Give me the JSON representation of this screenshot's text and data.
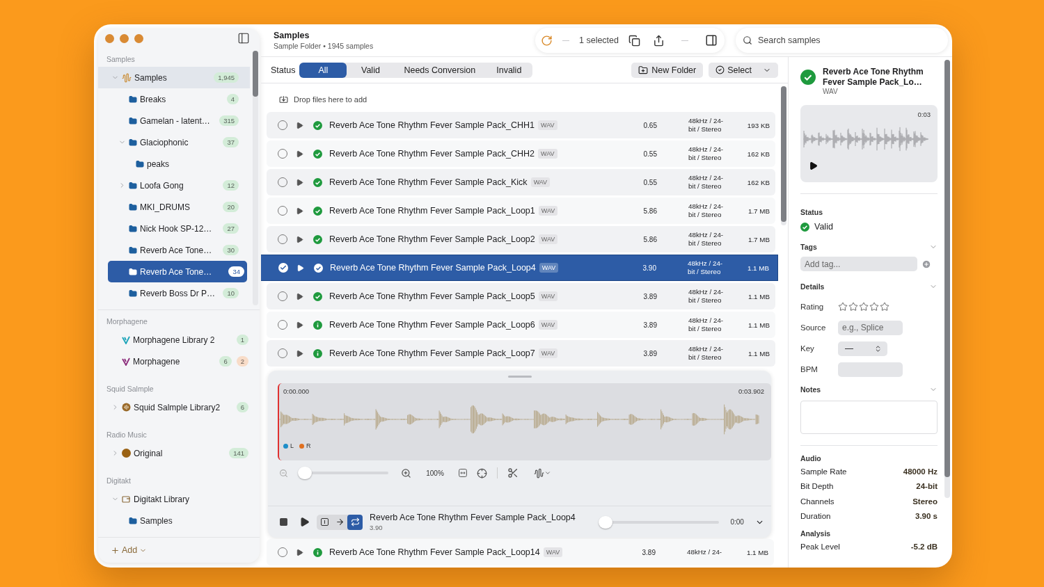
{
  "sidebar": {
    "sections": [
      {
        "title": "Samples",
        "items": [
          {
            "label": "Samples",
            "kind": "waveform",
            "badges": [
              {
                "text": "1,945",
                "color": "#d3ecd8"
              }
            ],
            "expanded": true,
            "selected": false,
            "highlighted": true,
            "children": [
              {
                "label": "Breaks",
                "kind": "folder",
                "badges": [
                  {
                    "text": "4",
                    "color": "#d3ecd8"
                  }
                ],
                "selected": false,
                "highlighted": false
              },
              {
                "label": "Gamelan - latent…",
                "kind": "folder",
                "badges": [
                  {
                    "text": "315",
                    "color": "#d3ecd8"
                  }
                ],
                "selected": false,
                "highlighted": false
              },
              {
                "label": "Glaciophonic",
                "kind": "folder",
                "badges": [
                  {
                    "text": "37",
                    "color": "#d3ecd8"
                  }
                ],
                "expanded": true,
                "selected": false,
                "highlighted": false,
                "children": [
                  {
                    "label": "peaks",
                    "kind": "folder",
                    "selected": false,
                    "highlighted": false
                  }
                ]
              },
              {
                "label": "Loofa Gong",
                "kind": "folder",
                "badges": [
                  {
                    "text": "12",
                    "color": "#d3ecd8"
                  }
                ],
                "expanded": false,
                "selected": false,
                "highlighted": false
              },
              {
                "label": "MKI_DRUMS",
                "kind": "folder",
                "badges": [
                  {
                    "text": "20",
                    "color": "#d3ecd8"
                  }
                ],
                "selected": false,
                "highlighted": false
              },
              {
                "label": "Nick Hook SP-12…",
                "kind": "folder",
                "badges": [
                  {
                    "text": "27",
                    "color": "#d3ecd8"
                  }
                ],
                "selected": false,
                "highlighted": false
              },
              {
                "label": "Reverb Ace Tone…",
                "kind": "folder",
                "badges": [
                  {
                    "text": "30",
                    "color": "#d3ecd8"
                  }
                ],
                "selected": false,
                "highlighted": false
              },
              {
                "label": "Reverb Ace Tone…",
                "kind": "folder",
                "badges": [
                  {
                    "text": "34",
                    "color": "#ffffff"
                  }
                ],
                "selected": true,
                "highlighted": false
              },
              {
                "label": "Reverb Boss Dr P…",
                "kind": "folder",
                "badges": [
                  {
                    "text": "10",
                    "color": "#d3ecd8"
                  }
                ],
                "selected": false,
                "highlighted": false
              }
            ]
          }
        ]
      },
      {
        "title": "Morphagene",
        "items": [
          {
            "label": "Morphagene Library 2",
            "kind": "morph",
            "color": "#1aa3b8",
            "badges": [
              {
                "text": "1",
                "color": "#d3ecd8"
              }
            ],
            "selected": false,
            "highlighted": false
          },
          {
            "label": "Morphagene",
            "kind": "morph",
            "color": "#8a2a7a",
            "badges": [
              {
                "text": "6",
                "color": "#d3ecd8"
              },
              {
                "text": "2",
                "color": "#f8dcc8"
              }
            ],
            "selected": false,
            "highlighted": false
          }
        ]
      },
      {
        "title": "Squid Salmple",
        "items": [
          {
            "label": "Squid Salmple Library2",
            "kind": "disc",
            "badges": [
              {
                "text": "6",
                "color": "#d3ecd8"
              }
            ],
            "expanded": false,
            "selected": false,
            "highlighted": false
          }
        ]
      },
      {
        "title": "Radio Music",
        "items": [
          {
            "label": "Original",
            "kind": "dot",
            "badges": [
              {
                "text": "141",
                "color": "#d3ecd8"
              }
            ],
            "expanded": false,
            "selected": false,
            "highlighted": false
          }
        ]
      },
      {
        "title": "Digitakt",
        "items": [
          {
            "label": "Digitakt Library",
            "kind": "card",
            "expanded": true,
            "selected": false,
            "highlighted": false,
            "children": [
              {
                "label": "Samples",
                "kind": "folder",
                "selected": false,
                "highlighted": false
              }
            ]
          }
        ]
      }
    ],
    "add_label": "Add"
  },
  "header": {
    "title": "Samples",
    "subtitle": "Sample Folder • 1945 samples",
    "selection": "1 selected",
    "search": {
      "placeholder": "Search samples"
    }
  },
  "filter": {
    "label": "Status",
    "segments": [
      {
        "label": "All",
        "selected": true
      },
      {
        "label": "Valid",
        "selected": false
      },
      {
        "label": "Needs Conversion",
        "selected": false
      },
      {
        "label": "Invalid",
        "selected": false
      }
    ],
    "new_folder": "New Folder",
    "select": "Select"
  },
  "drop_hint": "Drop files here to add",
  "rows": [
    {
      "name": "Reverb Ace Tone Rhythm Fever Sample Pack_CHH1",
      "format": "WAV",
      "kind": "valid",
      "duration": "0.65",
      "audio": "48kHz / 24-bit / Stereo",
      "size": "193 KB",
      "selected": false
    },
    {
      "name": "Reverb Ace Tone Rhythm Fever Sample Pack_CHH2",
      "format": "WAV",
      "kind": "valid",
      "duration": "0.55",
      "audio": "48kHz / 24-bit / Stereo",
      "size": "162 KB",
      "selected": false
    },
    {
      "name": "Reverb Ace Tone Rhythm Fever Sample Pack_Kick",
      "format": "WAV",
      "kind": "valid",
      "duration": "0.55",
      "audio": "48kHz / 24-bit / Stereo",
      "size": "162 KB",
      "selected": false
    },
    {
      "name": "Reverb Ace Tone Rhythm Fever Sample Pack_Loop1",
      "format": "WAV",
      "kind": "valid",
      "duration": "5.86",
      "audio": "48kHz / 24-bit / Stereo",
      "size": "1.7 MB",
      "selected": false
    },
    {
      "name": "Reverb Ace Tone Rhythm Fever Sample Pack_Loop2",
      "format": "WAV",
      "kind": "valid",
      "duration": "5.86",
      "audio": "48kHz / 24-bit / Stereo",
      "size": "1.7 MB",
      "selected": false
    },
    {
      "name": "Reverb Ace Tone Rhythm Fever Sample Pack_Loop4",
      "format": "WAV",
      "kind": "valid",
      "duration": "3.90",
      "audio": "48kHz / 24-bit / Stereo",
      "size": "1.1 MB",
      "selected": true
    },
    {
      "name": "Reverb Ace Tone Rhythm Fever Sample Pack_Loop5",
      "format": "WAV",
      "kind": "valid",
      "duration": "3.89",
      "audio": "48kHz / 24-bit / Stereo",
      "size": "1.1 MB",
      "selected": false
    },
    {
      "name": "Reverb Ace Tone Rhythm Fever Sample Pack_Loop6",
      "format": "WAV",
      "kind": "info",
      "duration": "3.89",
      "audio": "48kHz / 24-bit / Stereo",
      "size": "1.1 MB",
      "selected": false
    },
    {
      "name": "Reverb Ace Tone Rhythm Fever Sample Pack_Loop7",
      "format": "WAV",
      "kind": "info",
      "duration": "3.89",
      "audio": "48kHz / 24-bit / Stereo",
      "size": "1.1 MB",
      "selected": false
    }
  ],
  "last_row": {
    "name": "Reverb Ace Tone Rhythm Fever Sample Pack_Loop14",
    "format": "WAV",
    "kind": "info",
    "duration": "3.89",
    "audio": "48kHz / 24-",
    "size": "1.1 MB",
    "selected": false
  },
  "player": {
    "start": "0:00.000",
    "end": "0:03.902",
    "channels": [
      {
        "label": "L",
        "color": "#1e8ec8"
      },
      {
        "label": "R",
        "color": "#e07020"
      }
    ],
    "zoom": {
      "level": 0,
      "reading": "100%"
    },
    "modes": [
      {
        "kind": "once",
        "selected": false
      },
      {
        "kind": "next",
        "selected": false
      },
      {
        "kind": "loop",
        "selected": true
      }
    ],
    "title": "Reverb Ace Tone Rhythm Fever Sample Pack_Loop4",
    "duration": "3.90",
    "progress": {
      "level": 0,
      "reading": "0:00"
    }
  },
  "inspector": {
    "title": "Reverb Ace Tone Rhythm Fever Sample Pack_Lo…",
    "format": "WAV",
    "preview_time": "0:03",
    "status": {
      "heading": "Status",
      "value": "Valid"
    },
    "tags": {
      "heading": "Tags",
      "expanded": true,
      "placeholder": "Add tag..."
    },
    "details": {
      "heading": "Details",
      "expanded": true,
      "fields": [
        {
          "kind": "rating",
          "label": "Rating",
          "stars": 0
        },
        {
          "kind": "text",
          "label": "Source",
          "placeholder": "e.g., Splice"
        },
        {
          "kind": "select",
          "label": "Key",
          "value": "—"
        },
        {
          "kind": "text",
          "label": "BPM"
        }
      ]
    },
    "notes": {
      "heading": "Notes",
      "expanded": true
    },
    "groups": [
      {
        "heading": "Audio",
        "items": [
          {
            "label": "Sample Rate",
            "value": "48000 Hz"
          },
          {
            "label": "Bit Depth",
            "value": "24-bit"
          },
          {
            "label": "Channels",
            "value": "Stereo"
          },
          {
            "label": "Duration",
            "value": "3.90 s"
          }
        ]
      },
      {
        "heading": "Analysis",
        "items": [
          {
            "label": "Peak Level",
            "value": "-5.2 dB"
          }
        ]
      }
    ]
  }
}
